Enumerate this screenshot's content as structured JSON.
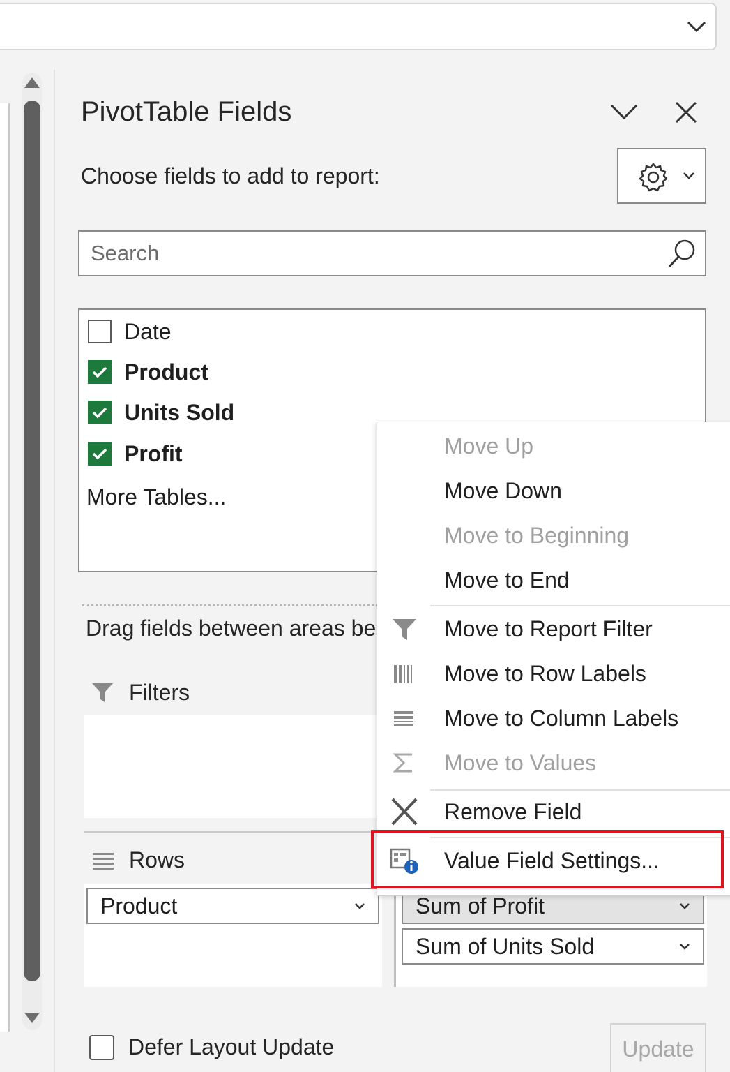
{
  "top_bar": {
    "dropdown_icon": "chevron-down-icon"
  },
  "pane": {
    "title": "PivotTable Fields",
    "choose_label": "Choose fields to add to report:",
    "search": {
      "placeholder": "Search",
      "value": ""
    },
    "fields": [
      {
        "label": "Date",
        "checked": false
      },
      {
        "label": "Product",
        "checked": true
      },
      {
        "label": "Units Sold",
        "checked": true
      },
      {
        "label": "Profit",
        "checked": true
      }
    ],
    "more_tables": "More Tables...",
    "drag_label": "Drag fields between areas below:",
    "areas": {
      "filters": {
        "label": "Filters"
      },
      "rows": {
        "label": "Rows",
        "items": [
          "Product"
        ]
      },
      "values": {
        "items": [
          "Sum of Profit",
          "Sum of Units Sold"
        ]
      }
    },
    "defer_label": "Defer Layout Update",
    "defer_checked": false,
    "update_button": "Update"
  },
  "context_menu": {
    "items": [
      {
        "label": "Move Up",
        "enabled": false,
        "icon": ""
      },
      {
        "label": "Move Down",
        "enabled": true,
        "icon": ""
      },
      {
        "label": "Move to Beginning",
        "enabled": false,
        "icon": ""
      },
      {
        "label": "Move to End",
        "enabled": true,
        "icon": ""
      },
      {
        "label": "Move to Report Filter",
        "enabled": true,
        "icon": "filter-icon"
      },
      {
        "label": "Move to Row Labels",
        "enabled": true,
        "icon": "row-labels-icon"
      },
      {
        "label": "Move to Column Labels",
        "enabled": true,
        "icon": "column-labels-icon"
      },
      {
        "label": "Move to Values",
        "enabled": false,
        "icon": "sigma-icon"
      },
      {
        "label": "Remove Field",
        "enabled": true,
        "icon": "remove-x-icon"
      },
      {
        "label": "Value Field Settings...",
        "enabled": true,
        "icon": "field-settings-info-icon",
        "highlighted": true
      }
    ]
  },
  "colors": {
    "checkbox_checked": "#1d7a3c",
    "highlight_border": "#e0141e"
  }
}
